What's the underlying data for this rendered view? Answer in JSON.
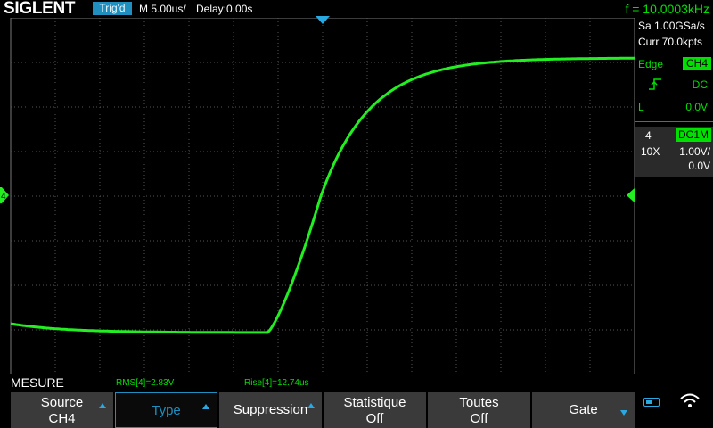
{
  "topbar": {
    "logo": "SIGLENT",
    "trig_status": "Trig'd",
    "timebase": "M 5.00us/",
    "delay": "Delay:0.00s",
    "frequency": "f = 10.0003kHz"
  },
  "right_panel": {
    "sample_rate": "Sa 1.00GSa/s",
    "memory_depth": "Curr 70.0kpts",
    "trigger_type": "Edge",
    "trigger_source": "CH4",
    "trigger_coupling": "DC",
    "level_label": "L",
    "trigger_level": "0.0V",
    "channel": {
      "number": "4",
      "coupling_impedance": "DC1M",
      "probe": "10X",
      "volts_per_div": "1.00V/",
      "offset": "0.0V"
    }
  },
  "waveform": {
    "channel_marker": "4",
    "color": "#22ee22",
    "description_shape": "rising edge from low level to high level"
  },
  "measure": {
    "title": "MESURE",
    "rms": "RMS[4]=2.83V",
    "rise": "Rise[4]=12.74us"
  },
  "softkeys": [
    {
      "line1": "Source",
      "line2": "CH4"
    },
    {
      "line1": "Type",
      "line2": ""
    },
    {
      "line1": "Suppression",
      "line2": ""
    },
    {
      "line1": "Statistique",
      "line2": "Off"
    },
    {
      "line1": "Toutes",
      "line2": "Off"
    },
    {
      "line1": "Gate",
      "line2": ""
    }
  ],
  "colors": {
    "accent": "#1e8fbf",
    "trace": "#22ee22",
    "status_green": "#00e000"
  },
  "icons": [
    "trigger-position-icon",
    "channel-offset-icon",
    "trigger-level-icon",
    "rising-edge-icon",
    "battery-icon",
    "wifi-icon"
  ]
}
